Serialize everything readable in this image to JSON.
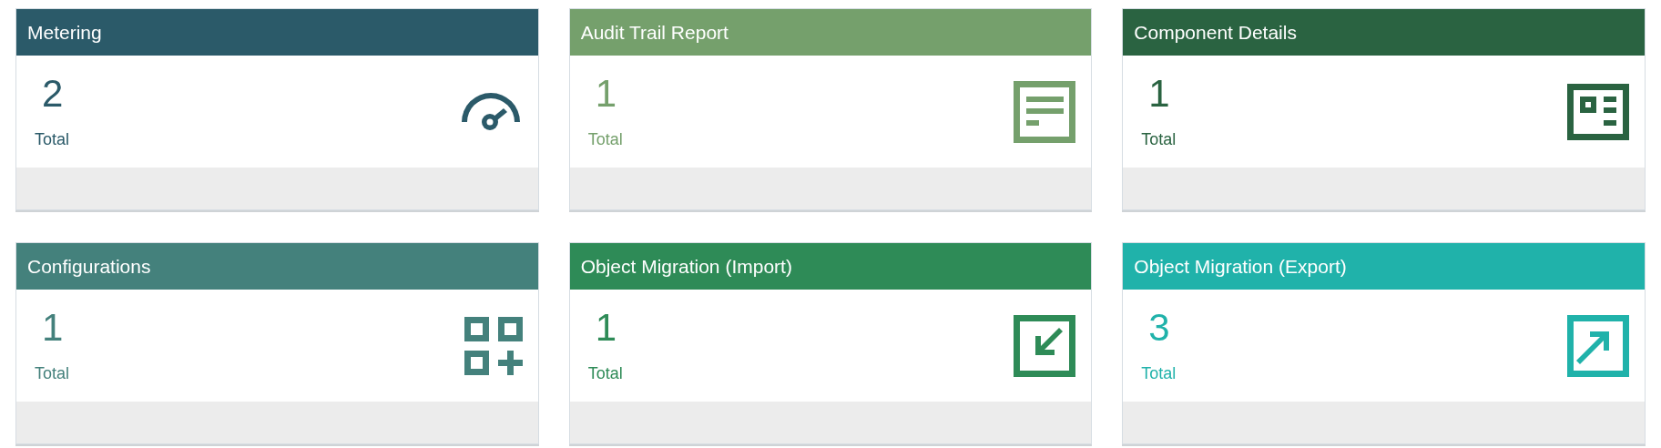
{
  "cards": [
    {
      "title": "Metering",
      "count": "2",
      "caption": "Total",
      "color": "#2b5a69",
      "kind": "gauge"
    },
    {
      "title": "Audit Trail Report",
      "count": "1",
      "caption": "Total",
      "color": "#75a06c",
      "kind": "document"
    },
    {
      "title": "Component Details",
      "count": "1",
      "caption": "Total",
      "color": "#2a6341",
      "kind": "details"
    },
    {
      "title": "Configurations",
      "count": "1",
      "caption": "Total",
      "color": "#44817c",
      "kind": "configure"
    },
    {
      "title": "Object Migration (Import)",
      "count": "1",
      "caption": "Total",
      "color": "#2e8b57",
      "kind": "import"
    },
    {
      "title": "Object Migration (Export)",
      "count": "3",
      "caption": "Total",
      "color": "#20b2aa",
      "kind": "export"
    }
  ]
}
